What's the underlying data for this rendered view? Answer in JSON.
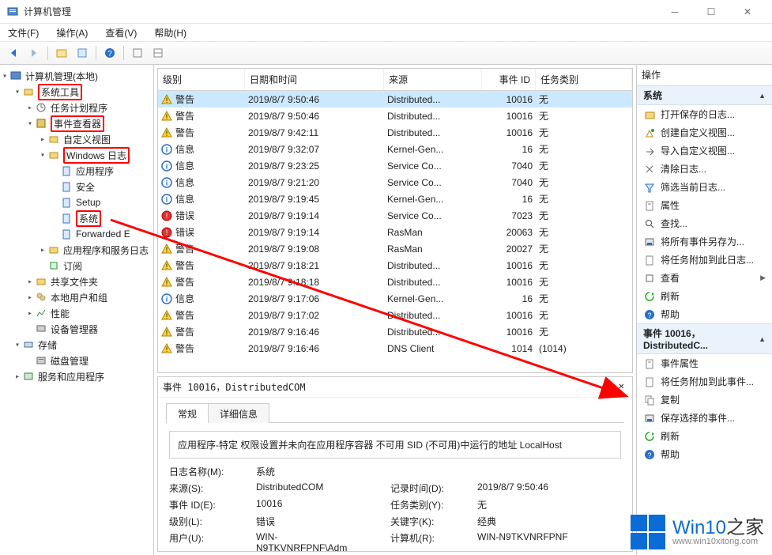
{
  "window": {
    "title": "计算机管理"
  },
  "menubar": [
    "文件(F)",
    "操作(A)",
    "查看(V)",
    "帮助(H)"
  ],
  "tree": {
    "root": "计算机管理(本地)",
    "system_tools": "系统工具",
    "task_scheduler": "任务计划程序",
    "event_viewer": "事件查看器",
    "custom_views": "自定义视图",
    "windows_logs": "Windows 日志",
    "application": "应用程序",
    "security": "安全",
    "setup": "Setup",
    "system": "系统",
    "forwarded": "Forwarded E",
    "apps_services": "应用程序和服务日志",
    "subscriptions": "订阅",
    "shared_folders": "共享文件夹",
    "local_users": "本地用户和组",
    "performance": "性能",
    "device_manager": "设备管理器",
    "storage": "存储",
    "disk_mgmt": "磁盘管理",
    "services_apps": "服务和应用程序"
  },
  "columns": {
    "level": "级别",
    "datetime": "日期和时间",
    "source": "来源",
    "eventid": "事件 ID",
    "task": "任务类别"
  },
  "levels": {
    "warn": "警告",
    "info": "信息",
    "error": "错误"
  },
  "events": [
    {
      "sev": "warn",
      "dt": "2019/8/7 9:50:46",
      "src": "Distributed...",
      "id": 10016,
      "task": "无"
    },
    {
      "sev": "warn",
      "dt": "2019/8/7 9:50:46",
      "src": "Distributed...",
      "id": 10016,
      "task": "无"
    },
    {
      "sev": "warn",
      "dt": "2019/8/7 9:42:11",
      "src": "Distributed...",
      "id": 10016,
      "task": "无"
    },
    {
      "sev": "info",
      "dt": "2019/8/7 9:32:07",
      "src": "Kernel-Gen...",
      "id": 16,
      "task": "无"
    },
    {
      "sev": "info",
      "dt": "2019/8/7 9:23:25",
      "src": "Service Co...",
      "id": 7040,
      "task": "无"
    },
    {
      "sev": "info",
      "dt": "2019/8/7 9:21:20",
      "src": "Service Co...",
      "id": 7040,
      "task": "无"
    },
    {
      "sev": "info",
      "dt": "2019/8/7 9:19:45",
      "src": "Kernel-Gen...",
      "id": 16,
      "task": "无"
    },
    {
      "sev": "error",
      "dt": "2019/8/7 9:19:14",
      "src": "Service Co...",
      "id": 7023,
      "task": "无"
    },
    {
      "sev": "error",
      "dt": "2019/8/7 9:19:14",
      "src": "RasMan",
      "id": 20063,
      "task": "无"
    },
    {
      "sev": "warn",
      "dt": "2019/8/7 9:19:08",
      "src": "RasMan",
      "id": 20027,
      "task": "无"
    },
    {
      "sev": "warn",
      "dt": "2019/8/7 9:18:21",
      "src": "Distributed...",
      "id": 10016,
      "task": "无"
    },
    {
      "sev": "warn",
      "dt": "2019/8/7 9:18:18",
      "src": "Distributed...",
      "id": 10016,
      "task": "无"
    },
    {
      "sev": "info",
      "dt": "2019/8/7 9:17:06",
      "src": "Kernel-Gen...",
      "id": 16,
      "task": "无"
    },
    {
      "sev": "warn",
      "dt": "2019/8/7 9:17:02",
      "src": "Distributed...",
      "id": 10016,
      "task": "无"
    },
    {
      "sev": "warn",
      "dt": "2019/8/7 9:16:46",
      "src": "Distributed...",
      "id": 10016,
      "task": "无"
    },
    {
      "sev": "warn",
      "dt": "2019/8/7 9:16:46",
      "src": "DNS Client",
      "id": 1014,
      "task": "(1014)"
    }
  ],
  "details": {
    "title": "事件 10016，DistributedCOM",
    "tabs": {
      "general": "常规",
      "details": "详细信息"
    },
    "message": "应用程序-特定 权限设置并未向在应用程序容器 不可用 SID (不可用)中运行的地址 LocalHost",
    "fields": {
      "logname_k": "日志名称(M):",
      "logname_v": "系统",
      "source_k": "来源(S):",
      "source_v": "DistributedCOM",
      "logged_k": "记录时间(D):",
      "logged_v": "2019/8/7 9:50:46",
      "eventid_k": "事件 ID(E):",
      "eventid_v": "10016",
      "task_k": "任务类别(Y):",
      "task_v": "无",
      "level_k": "级别(L):",
      "level_v": "错误",
      "keywords_k": "关键字(K):",
      "keywords_v": "经典",
      "user_k": "用户(U):",
      "user_v": "WIN-N9TKVNRFPNF\\Adm",
      "computer_k": "计算机(R):",
      "computer_v": "WIN-N9TKVNRFPNF"
    }
  },
  "actions": {
    "header": "操作",
    "section1_title": "系统",
    "section2_title": "事件 10016，DistributedC...",
    "s1": [
      "打开保存的日志...",
      "创建自定义视图...",
      "导入自定义视图...",
      "清除日志...",
      "筛选当前日志...",
      "属性",
      "查找...",
      "将所有事件另存为...",
      "将任务附加到此日志...",
      "查看",
      "刷新",
      "帮助"
    ],
    "s2": [
      "事件属性",
      "将任务附加到此事件...",
      "复制",
      "保存选择的事件...",
      "刷新",
      "帮助"
    ]
  },
  "watermark": {
    "brand_a": "Win10",
    "brand_b": "之家",
    "url": "www.win10xitong.com"
  }
}
